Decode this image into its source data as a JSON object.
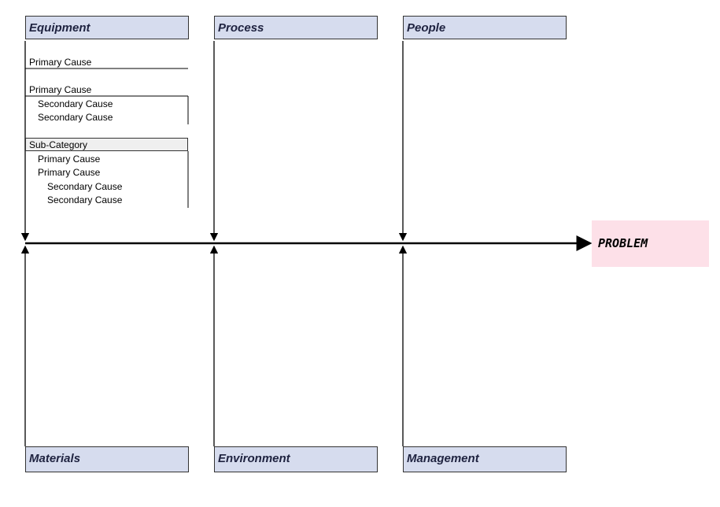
{
  "diagram": {
    "type": "fishbone",
    "problem": "PROBLEM"
  },
  "categories": {
    "top": [
      "Equipment",
      "Process",
      "People"
    ],
    "bottom": [
      "Materials",
      "Environment",
      "Management"
    ]
  },
  "equipment_example": {
    "primary1": "Primary Cause",
    "primary2": "Primary Cause",
    "secondary1": "Secondary Cause",
    "secondary2": "Secondary Cause",
    "subcategory": "Sub-Category",
    "sub_primary1": "Primary Cause",
    "sub_primary2": "Primary Cause",
    "sub_secondary1": "Secondary Cause",
    "sub_secondary2": "Secondary Cause"
  },
  "colors": {
    "category_fill": "#d6dcee",
    "problem_fill": "#fde0e8",
    "line": "#000000"
  }
}
